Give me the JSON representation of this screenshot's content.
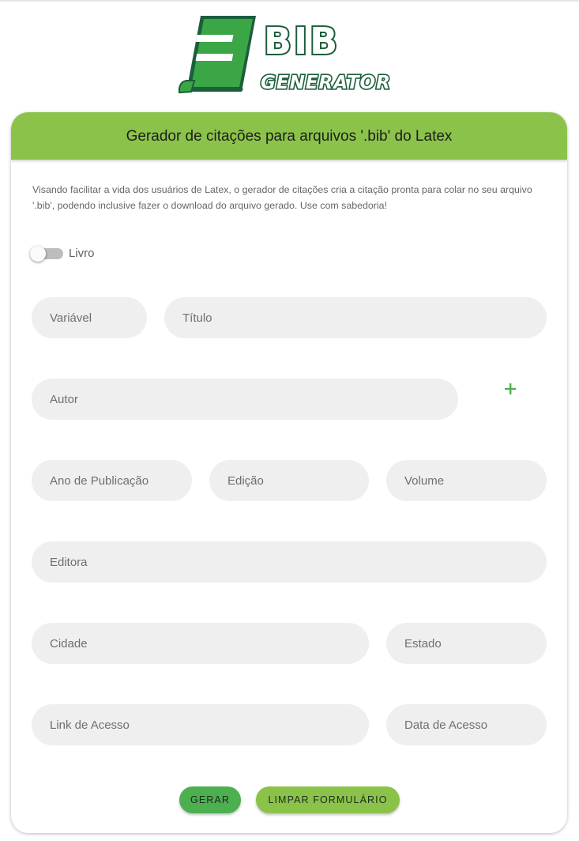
{
  "colors": {
    "brand_green": "#8bc34a",
    "button_green": "#4caf50",
    "logo_dark": "#1b5e3b",
    "logo_green": "#3aa646",
    "field_bg": "#efefef"
  },
  "logo": {
    "line1": "BIB",
    "line2": "GENERATOR",
    "icon": "book-icon"
  },
  "card": {
    "title": "Gerador de citações para arquivos '.bib' do Latex",
    "description": "Visando facilitar a vida dos usuários de Latex, o gerador de citações cria a citação pronta para colar no seu arquivo '.bib', podendo inclusive fazer o download do arquivo gerado. Use com sabedoria!"
  },
  "toggle": {
    "label": "Livro",
    "checked": false
  },
  "fields": {
    "variavel": "Variável",
    "titulo": "Título",
    "autor": "Autor",
    "ano": "Ano de Publicação",
    "edicao": "Edição",
    "volume": "Volume",
    "editora": "Editora",
    "cidade": "Cidade",
    "estado": "Estado",
    "link": "Link de Acesso",
    "data": "Data de Acesso"
  },
  "add_author_icon": "plus-icon",
  "buttons": {
    "gerar": "GERAR",
    "limpar": "LIMPAR FORMULÁRIO"
  }
}
